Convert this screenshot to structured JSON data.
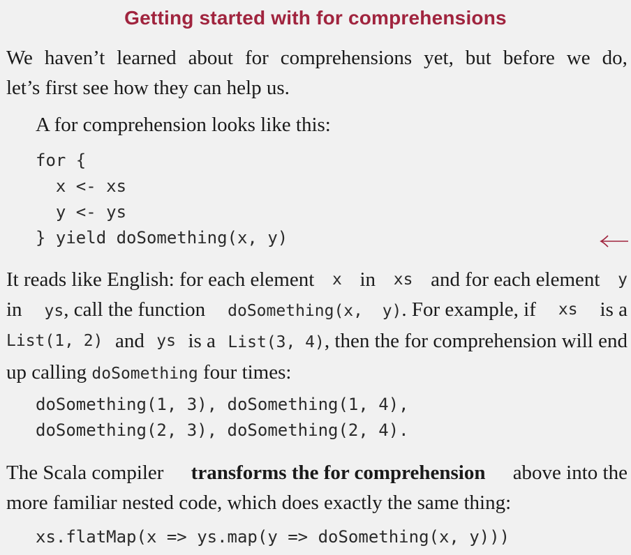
{
  "title": "Getting started with for comprehensions",
  "intro": {
    "line1": [
      "We",
      "haven’t",
      "learned",
      "about",
      "for",
      "comprehensions",
      "yet,",
      "but",
      "before",
      "we",
      "do,"
    ],
    "line2": "let’s first see how they can help us."
  },
  "lead": "A for comprehension looks like this:",
  "for_code": [
    "for {",
    "  x <- xs",
    "  y <- ys",
    "} yield doSomething(x, y)"
  ],
  "explain": {
    "l1": {
      "a": "It reads like English: for each element",
      "c1": "x",
      "b": "in",
      "c2": "xs",
      "d": "and for each element",
      "c3": "y"
    },
    "l2": {
      "a": "in",
      "c1": "ys",
      "b": ", call the function",
      "c2": "doSomething(x,  y)",
      "d": ". For example, if",
      "c3": "xs",
      "e": "is a"
    },
    "l3": {
      "c1": "List(1, 2)",
      "a": "and",
      "c2": "ys",
      "b": "is a",
      "c3": "List(3, 4)",
      "d": ", then the for comprehension will end"
    },
    "l4": {
      "a": "up calling",
      "c1": "doSomething",
      "b": "four times:"
    }
  },
  "calls_code": [
    "doSomething(1, 3), doSomething(1, 4),",
    "doSomething(2, 3), doSomething(2, 4)."
  ],
  "compiler": {
    "l1a": "The Scala compiler",
    "l1bold": "transforms the for comprehension",
    "l1b": "above into the",
    "l2": "more familiar nested code, which does exactly the same thing:"
  },
  "nested_code": "xs.flatMap(x => ys.map(y => doSomething(x, y)))",
  "colors": {
    "title": "#a0243e",
    "background": "#f1f1f1",
    "arrow": "#a0243e"
  },
  "icons": {
    "margin_arrow": "left-arrow-icon"
  }
}
